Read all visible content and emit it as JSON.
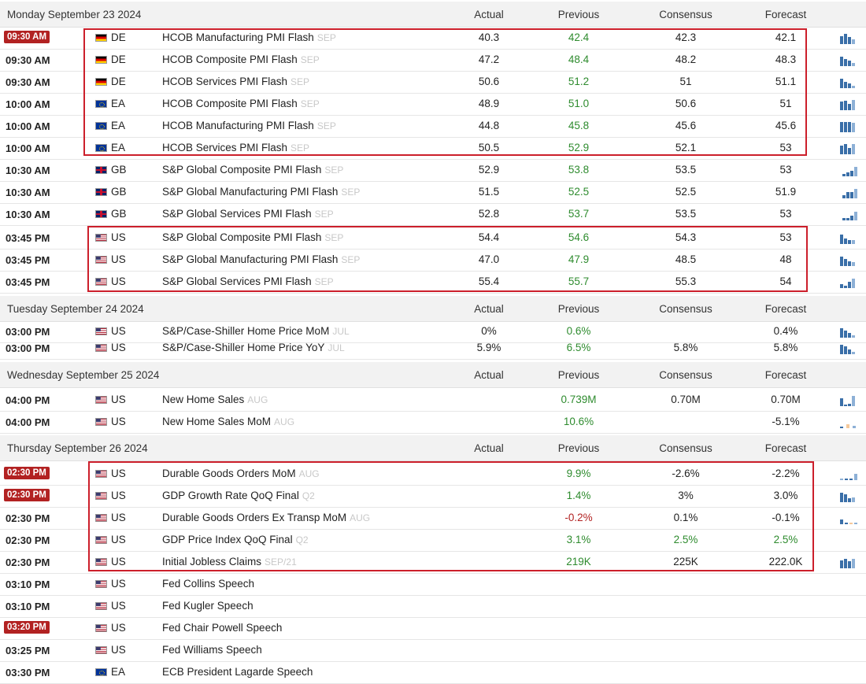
{
  "columns": {
    "actual": "Actual",
    "previous": "Previous",
    "consensus": "Consensus",
    "forecast": "Forecast"
  },
  "days": [
    {
      "date": "Monday September 23 2024"
    },
    {
      "date": "Tuesday September 24 2024"
    },
    {
      "date": "Wednesday September 25 2024"
    },
    {
      "date": "Thursday September 26 2024"
    }
  ],
  "rows": [
    {
      "time": "09:30 AM",
      "country": "DE",
      "event": "HCOB Manufacturing PMI Flash",
      "ref": "SEP",
      "actual": "40.3",
      "previous": "42.4",
      "consensus": "42.3",
      "forecast": "42.1",
      "icon": "bar-chart-icon"
    },
    {
      "time": "09:30 AM",
      "country": "DE",
      "event": "HCOB Composite PMI Flash",
      "ref": "SEP",
      "actual": "47.2",
      "previous": "48.4",
      "consensus": "48.2",
      "forecast": "48.3",
      "icon": "bar-chart-icon"
    },
    {
      "time": "09:30 AM",
      "country": "DE",
      "event": "HCOB Services PMI Flash",
      "ref": "SEP",
      "actual": "50.6",
      "previous": "51.2",
      "consensus": "51",
      "forecast": "51.1",
      "icon": "bar-chart-icon"
    },
    {
      "time": "10:00 AM",
      "country": "EA",
      "event": "HCOB Composite PMI Flash",
      "ref": "SEP",
      "actual": "48.9",
      "previous": "51.0",
      "consensus": "50.6",
      "forecast": "51",
      "icon": "bar-chart-icon"
    },
    {
      "time": "10:00 AM",
      "country": "EA",
      "event": "HCOB Manufacturing PMI Flash",
      "ref": "SEP",
      "actual": "44.8",
      "previous": "45.8",
      "consensus": "45.6",
      "forecast": "45.6",
      "icon": "bar-chart-icon"
    },
    {
      "time": "10:00 AM",
      "country": "EA",
      "event": "HCOB Services PMI Flash",
      "ref": "SEP",
      "actual": "50.5",
      "previous": "52.9",
      "consensus": "52.1",
      "forecast": "53",
      "icon": "bar-chart-icon"
    },
    {
      "time": "10:30 AM",
      "country": "GB",
      "event": "S&P Global Composite PMI Flash",
      "ref": "SEP",
      "actual": "52.9",
      "previous": "53.8",
      "consensus": "53.5",
      "forecast": "53",
      "icon": "bar-chart-icon"
    },
    {
      "time": "10:30 AM",
      "country": "GB",
      "event": "S&P Global Manufacturing PMI Flash",
      "ref": "SEP",
      "actual": "51.5",
      "previous": "52.5",
      "consensus": "52.5",
      "forecast": "51.9",
      "icon": "bar-chart-icon"
    },
    {
      "time": "10:30 AM",
      "country": "GB",
      "event": "S&P Global Services PMI Flash",
      "ref": "SEP",
      "actual": "52.8",
      "previous": "53.7",
      "consensus": "53.5",
      "forecast": "53",
      "icon": "bar-chart-icon"
    },
    {
      "time": "03:45 PM",
      "country": "US",
      "event": "S&P Global Composite PMI Flash",
      "ref": "SEP",
      "actual": "54.4",
      "previous": "54.6",
      "consensus": "54.3",
      "forecast": "53",
      "icon": "bar-chart-icon"
    },
    {
      "time": "03:45 PM",
      "country": "US",
      "event": "S&P Global Manufacturing PMI Flash",
      "ref": "SEP",
      "actual": "47.0",
      "previous": "47.9",
      "consensus": "48.5",
      "forecast": "48",
      "icon": "bar-chart-icon"
    },
    {
      "time": "03:45 PM",
      "country": "US",
      "event": "S&P Global Services PMI Flash",
      "ref": "SEP",
      "actual": "55.4",
      "previous": "55.7",
      "consensus": "55.3",
      "forecast": "54",
      "icon": "bar-chart-icon"
    },
    {
      "time": "03:00 PM",
      "country": "US",
      "event": "S&P/Case-Shiller Home Price MoM",
      "ref": "JUL",
      "actual": "0%",
      "previous": "0.6%",
      "consensus": "",
      "forecast": "0.4%",
      "icon": "bar-chart-icon"
    },
    {
      "time": "03:00 PM",
      "country": "US",
      "event": "S&P/Case-Shiller Home Price YoY",
      "ref": "JUL",
      "actual": "5.9%",
      "previous": "6.5%",
      "consensus": "5.8%",
      "forecast": "5.8%",
      "icon": "bar-chart-icon"
    },
    {
      "time": "04:00 PM",
      "country": "US",
      "event": "New Home Sales",
      "ref": "AUG",
      "actual": "",
      "previous": "0.739M",
      "consensus": "0.70M",
      "forecast": "0.70M",
      "icon": "bar-chart-icon"
    },
    {
      "time": "04:00 PM",
      "country": "US",
      "event": "New Home Sales MoM",
      "ref": "AUG",
      "actual": "",
      "previous": "10.6%",
      "consensus": "",
      "forecast": "-5.1%",
      "icon": "bar-chart-icon"
    },
    {
      "time": "02:30 PM",
      "country": "US",
      "event": "Durable Goods Orders MoM",
      "ref": "AUG",
      "actual": "",
      "previous": "9.9%",
      "consensus": "-2.6%",
      "forecast": "-2.2%",
      "icon": "bar-chart-icon"
    },
    {
      "time": "02:30 PM",
      "country": "US",
      "event": "GDP Growth Rate QoQ Final",
      "ref": "Q2",
      "actual": "",
      "previous": "1.4%",
      "consensus": "3%",
      "forecast": "3.0%",
      "icon": "bar-chart-icon"
    },
    {
      "time": "02:30 PM",
      "country": "US",
      "event": "Durable Goods Orders Ex Transp MoM",
      "ref": "AUG",
      "actual": "",
      "previous": "-0.2%",
      "consensus": "0.1%",
      "forecast": "-0.1%",
      "icon": "bar-chart-icon"
    },
    {
      "time": "02:30 PM",
      "country": "US",
      "event": "GDP Price Index QoQ Final",
      "ref": "Q2",
      "actual": "",
      "previous": "3.1%",
      "consensus": "2.5%",
      "forecast": "2.5%",
      "icon": ""
    },
    {
      "time": "02:30 PM",
      "country": "US",
      "event": "Initial Jobless Claims",
      "ref": "SEP/21",
      "actual": "",
      "previous": "219K",
      "consensus": "225K",
      "forecast": "222.0K",
      "icon": "bar-chart-icon"
    },
    {
      "time": "03:10 PM",
      "country": "US",
      "event": "Fed Collins Speech",
      "ref": "",
      "actual": "",
      "previous": "",
      "consensus": "",
      "forecast": "",
      "icon": ""
    },
    {
      "time": "03:10 PM",
      "country": "US",
      "event": "Fed Kugler Speech",
      "ref": "",
      "actual": "",
      "previous": "",
      "consensus": "",
      "forecast": "",
      "icon": ""
    },
    {
      "time": "03:20 PM",
      "country": "US",
      "event": "Fed Chair Powell Speech",
      "ref": "",
      "actual": "",
      "previous": "",
      "consensus": "",
      "forecast": "",
      "icon": ""
    },
    {
      "time": "03:25 PM",
      "country": "US",
      "event": "Fed Williams Speech",
      "ref": "",
      "actual": "",
      "previous": "",
      "consensus": "",
      "forecast": "",
      "icon": ""
    },
    {
      "time": "03:30 PM",
      "country": "EA",
      "event": "ECB President Lagarde Speech",
      "ref": "",
      "actual": "",
      "previous": "",
      "consensus": "",
      "forecast": "",
      "icon": ""
    }
  ],
  "colors": {
    "highlight": "#cc1f2b",
    "positive": "#2e8b2e",
    "negative": "#b22222",
    "badge": "#b22222"
  }
}
